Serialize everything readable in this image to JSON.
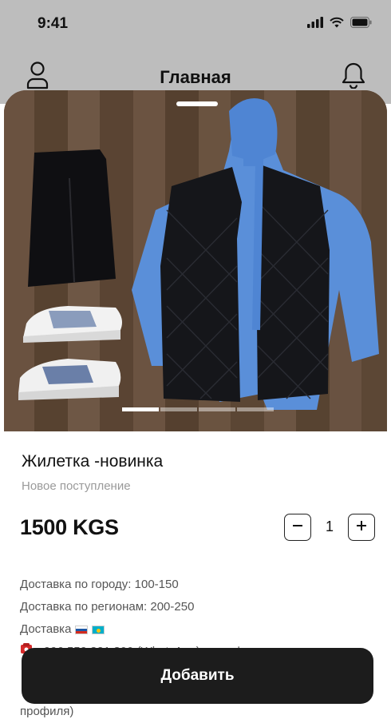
{
  "status_bar": {
    "time": "9:41"
  },
  "header": {
    "title": "Главная"
  },
  "product": {
    "name": "Жилетка -новинка",
    "subtitle": "Новое поступление",
    "price": "1500 KGS",
    "quantity": "1",
    "gallery": {
      "slides": 4,
      "active_index": 0
    }
  },
  "info": {
    "lines": [
      "Доставка по городу: 100-150",
      "Доставка по регионам: 200-250",
      "Доставка",
      "+996 559 321 800 (WhatsApp) для оформления"
    ],
    "partial": "профиля)"
  },
  "actions": {
    "add_label": "Добавить"
  },
  "icons": {
    "profile": "profile-icon",
    "bell": "bell-icon",
    "minus": "minus-icon",
    "plus": "plus-icon",
    "phone": "phone-icon",
    "flag_ru": "russia-flag-icon",
    "flag_kz": "kazakhstan-flag-icon"
  },
  "colors": {
    "header_bg": "#bdbdbd",
    "button_bg": "#1c1c1c",
    "text_muted": "#9a9a9a"
  }
}
